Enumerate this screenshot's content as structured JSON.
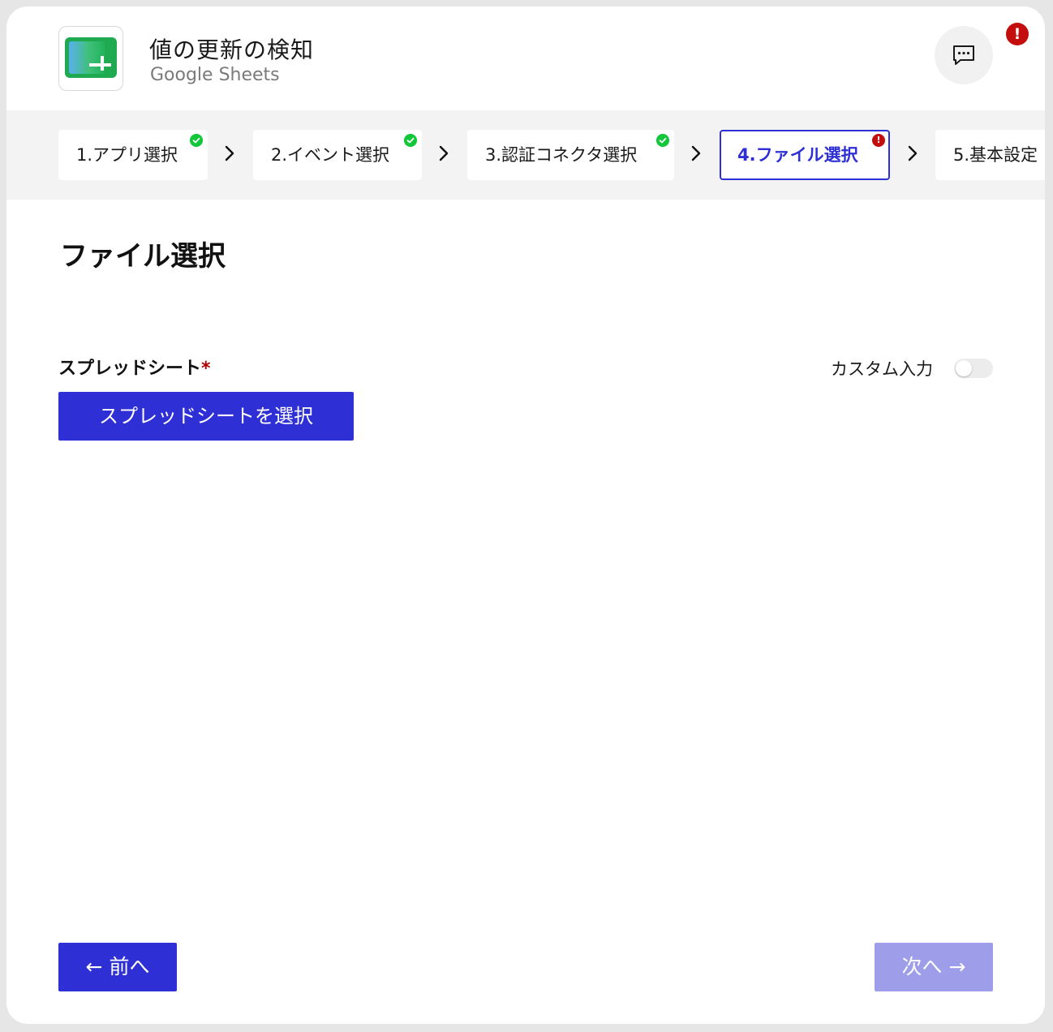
{
  "header": {
    "title": "値の更新の検知",
    "subtitle": "Google Sheets",
    "app_icon": "google-sheets-icon",
    "chat_icon": "chat-bubble-icon",
    "alert_badge": "!"
  },
  "stepper": {
    "steps": [
      {
        "label": "1.アプリ選択",
        "status": "done"
      },
      {
        "label": "2.イベント選択",
        "status": "done"
      },
      {
        "label": "3.認証コネクタ選択",
        "status": "done"
      },
      {
        "label": "4.ファイル選択",
        "status": "error",
        "error_mark": "!"
      },
      {
        "label": "5.基本設定",
        "status": "pending"
      }
    ]
  },
  "main": {
    "title": "ファイル選択",
    "field_label": "スプレッドシート",
    "required_mark": "*",
    "custom_input_label": "カスタム入力",
    "custom_input_enabled": false,
    "select_button_label": "スプレッドシートを選択"
  },
  "footer": {
    "prev_label": "← 前へ",
    "next_label": "次へ →"
  },
  "colors": {
    "accent": "#2f2fd6",
    "accent_disabled": "#9d9de9",
    "success": "#12c83a",
    "error": "#c40d0d"
  }
}
